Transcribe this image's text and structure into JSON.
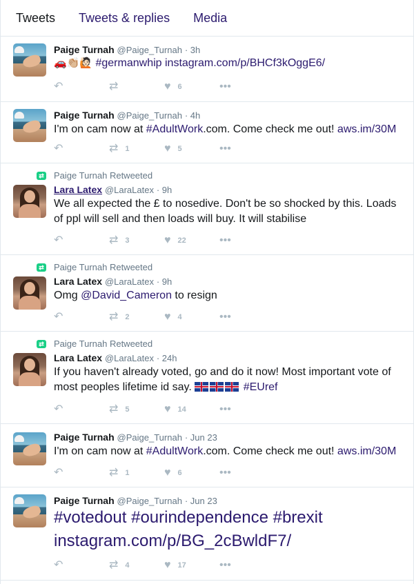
{
  "tabs": [
    "Tweets",
    "Tweets & replies",
    "Media"
  ],
  "tweets": [
    {
      "name": "Paige Turnah",
      "handle": "@Paige_Turnah",
      "time": "· 3h",
      "emoji": "🚗👏🏼🙋🏻",
      "text": "",
      "links": "#germanwhip instagram.com/p/BHCf3kOggE6/",
      "retweets": "",
      "likes": "6"
    },
    {
      "name": "Paige Turnah",
      "handle": "@Paige_Turnah",
      "time": "· 4h",
      "text": "I'm on cam now at ",
      "link1": "#AdultWork",
      "text2": ".com. Come check me out! ",
      "link2": "aws.im/30M",
      "retweets": "1",
      "likes": "5"
    },
    {
      "retweet_label": "Paige Turnah Retweeted",
      "name": "Lara Latex",
      "handle": "@LaraLatex",
      "time": "· 9h",
      "text": "We all expected the £ to nosedive. Don't be so shocked by this. Loads of ppl will sell and then loads will buy. It will stabilise",
      "retweets": "3",
      "likes": "22"
    },
    {
      "retweet_label": "Paige Turnah Retweeted",
      "name": "Lara Latex",
      "handle": "@LaraLatex",
      "time": "· 9h",
      "text": "Omg ",
      "link1": "@David_Cameron",
      "text2": " to resign",
      "retweets": "2",
      "likes": "4"
    },
    {
      "retweet_label": "Paige Turnah Retweeted",
      "name": "Lara Latex",
      "handle": "@LaraLatex",
      "time": "· 24h",
      "text": "If you haven't already voted, go and do it now! Most important vote of most peoples lifetime id say. ",
      "link1": "#EUref",
      "retweets": "5",
      "likes": "14"
    },
    {
      "name": "Paige Turnah",
      "handle": "@Paige_Turnah",
      "time": "· Jun 23",
      "text": "I'm on cam now at ",
      "link1": "#AdultWork",
      "text2": ".com. Come check me out! ",
      "link2": "aws.im/30M",
      "retweets": "1",
      "likes": "6"
    },
    {
      "name": "Paige Turnah",
      "handle": "@Paige_Turnah",
      "time": "· Jun 23",
      "text": "#votedout #ourindependence #brexit instagram.com/p/BG_2cBwldF7/",
      "retweets": "4",
      "likes": "17"
    }
  ],
  "icons": {
    "reply": "reply-icon",
    "retweet": "retweet-icon",
    "like": "heart-icon",
    "more": "more-icon"
  }
}
